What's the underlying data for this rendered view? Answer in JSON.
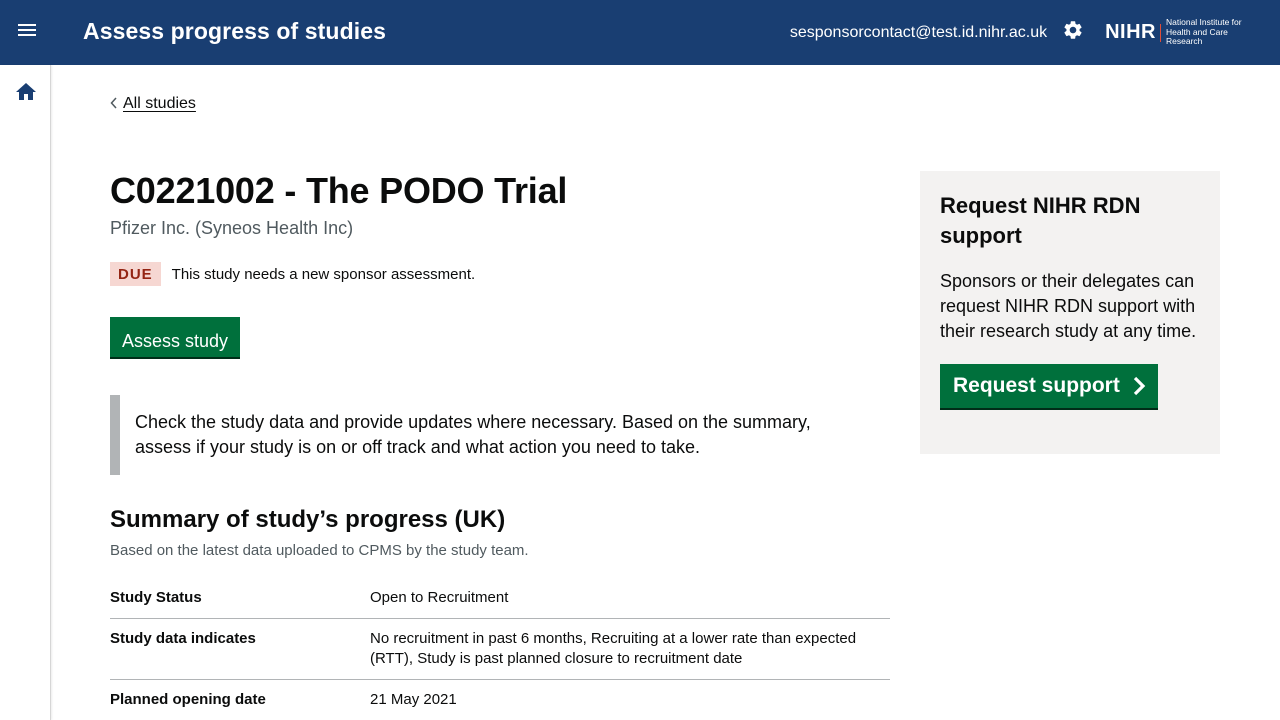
{
  "header": {
    "title": "Assess progress of studies",
    "user_email": "sesponsorcontact@test.id.nihr.ac.uk",
    "logo_mark": "NIHR",
    "logo_text_line1": "National Institute for",
    "logo_text_line2": "Health and Care Research",
    "menu_icon": "menu-icon",
    "settings_icon": "gear-icon"
  },
  "sidebar": {
    "home_icon": "home-icon"
  },
  "breadcrumb": {
    "back_label": "All studies"
  },
  "study": {
    "title": "C0221002 - The PODO Trial",
    "sponsor": "Pfizer Inc. (Syneos Health Inc)",
    "status_tag": "DUE",
    "status_text": "This study needs a new sponsor assessment.",
    "assess_button": "Assess study"
  },
  "inset": {
    "text": "Check the study data and provide updates where necessary. Based on the summary, assess if your study is on or off track and what action you need to take."
  },
  "summary": {
    "heading": "Summary of study’s progress (UK)",
    "hint": "Based on the latest data uploaded to CPMS by the study team.",
    "rows": [
      {
        "key": "Study Status",
        "value": "Open to Recruitment"
      },
      {
        "key": "Study data indicates",
        "value": "No recruitment in past 6 months, Recruiting at a lower rate than expected (RTT), Study is past planned closure to recruitment date"
      },
      {
        "key": "Planned opening date",
        "value": "21 May 2021"
      }
    ]
  },
  "support": {
    "heading": "Request NIHR RDN support",
    "body": "Sponsors or their delegates can request NIHR RDN support with their research study at any time.",
    "button": "Request support"
  },
  "colors": {
    "header_bg": "#193e72",
    "primary_button": "#00703c",
    "due_tag_bg": "#f6d7d2",
    "due_tag_text": "#942514",
    "panel_bg": "#f3f2f1"
  }
}
